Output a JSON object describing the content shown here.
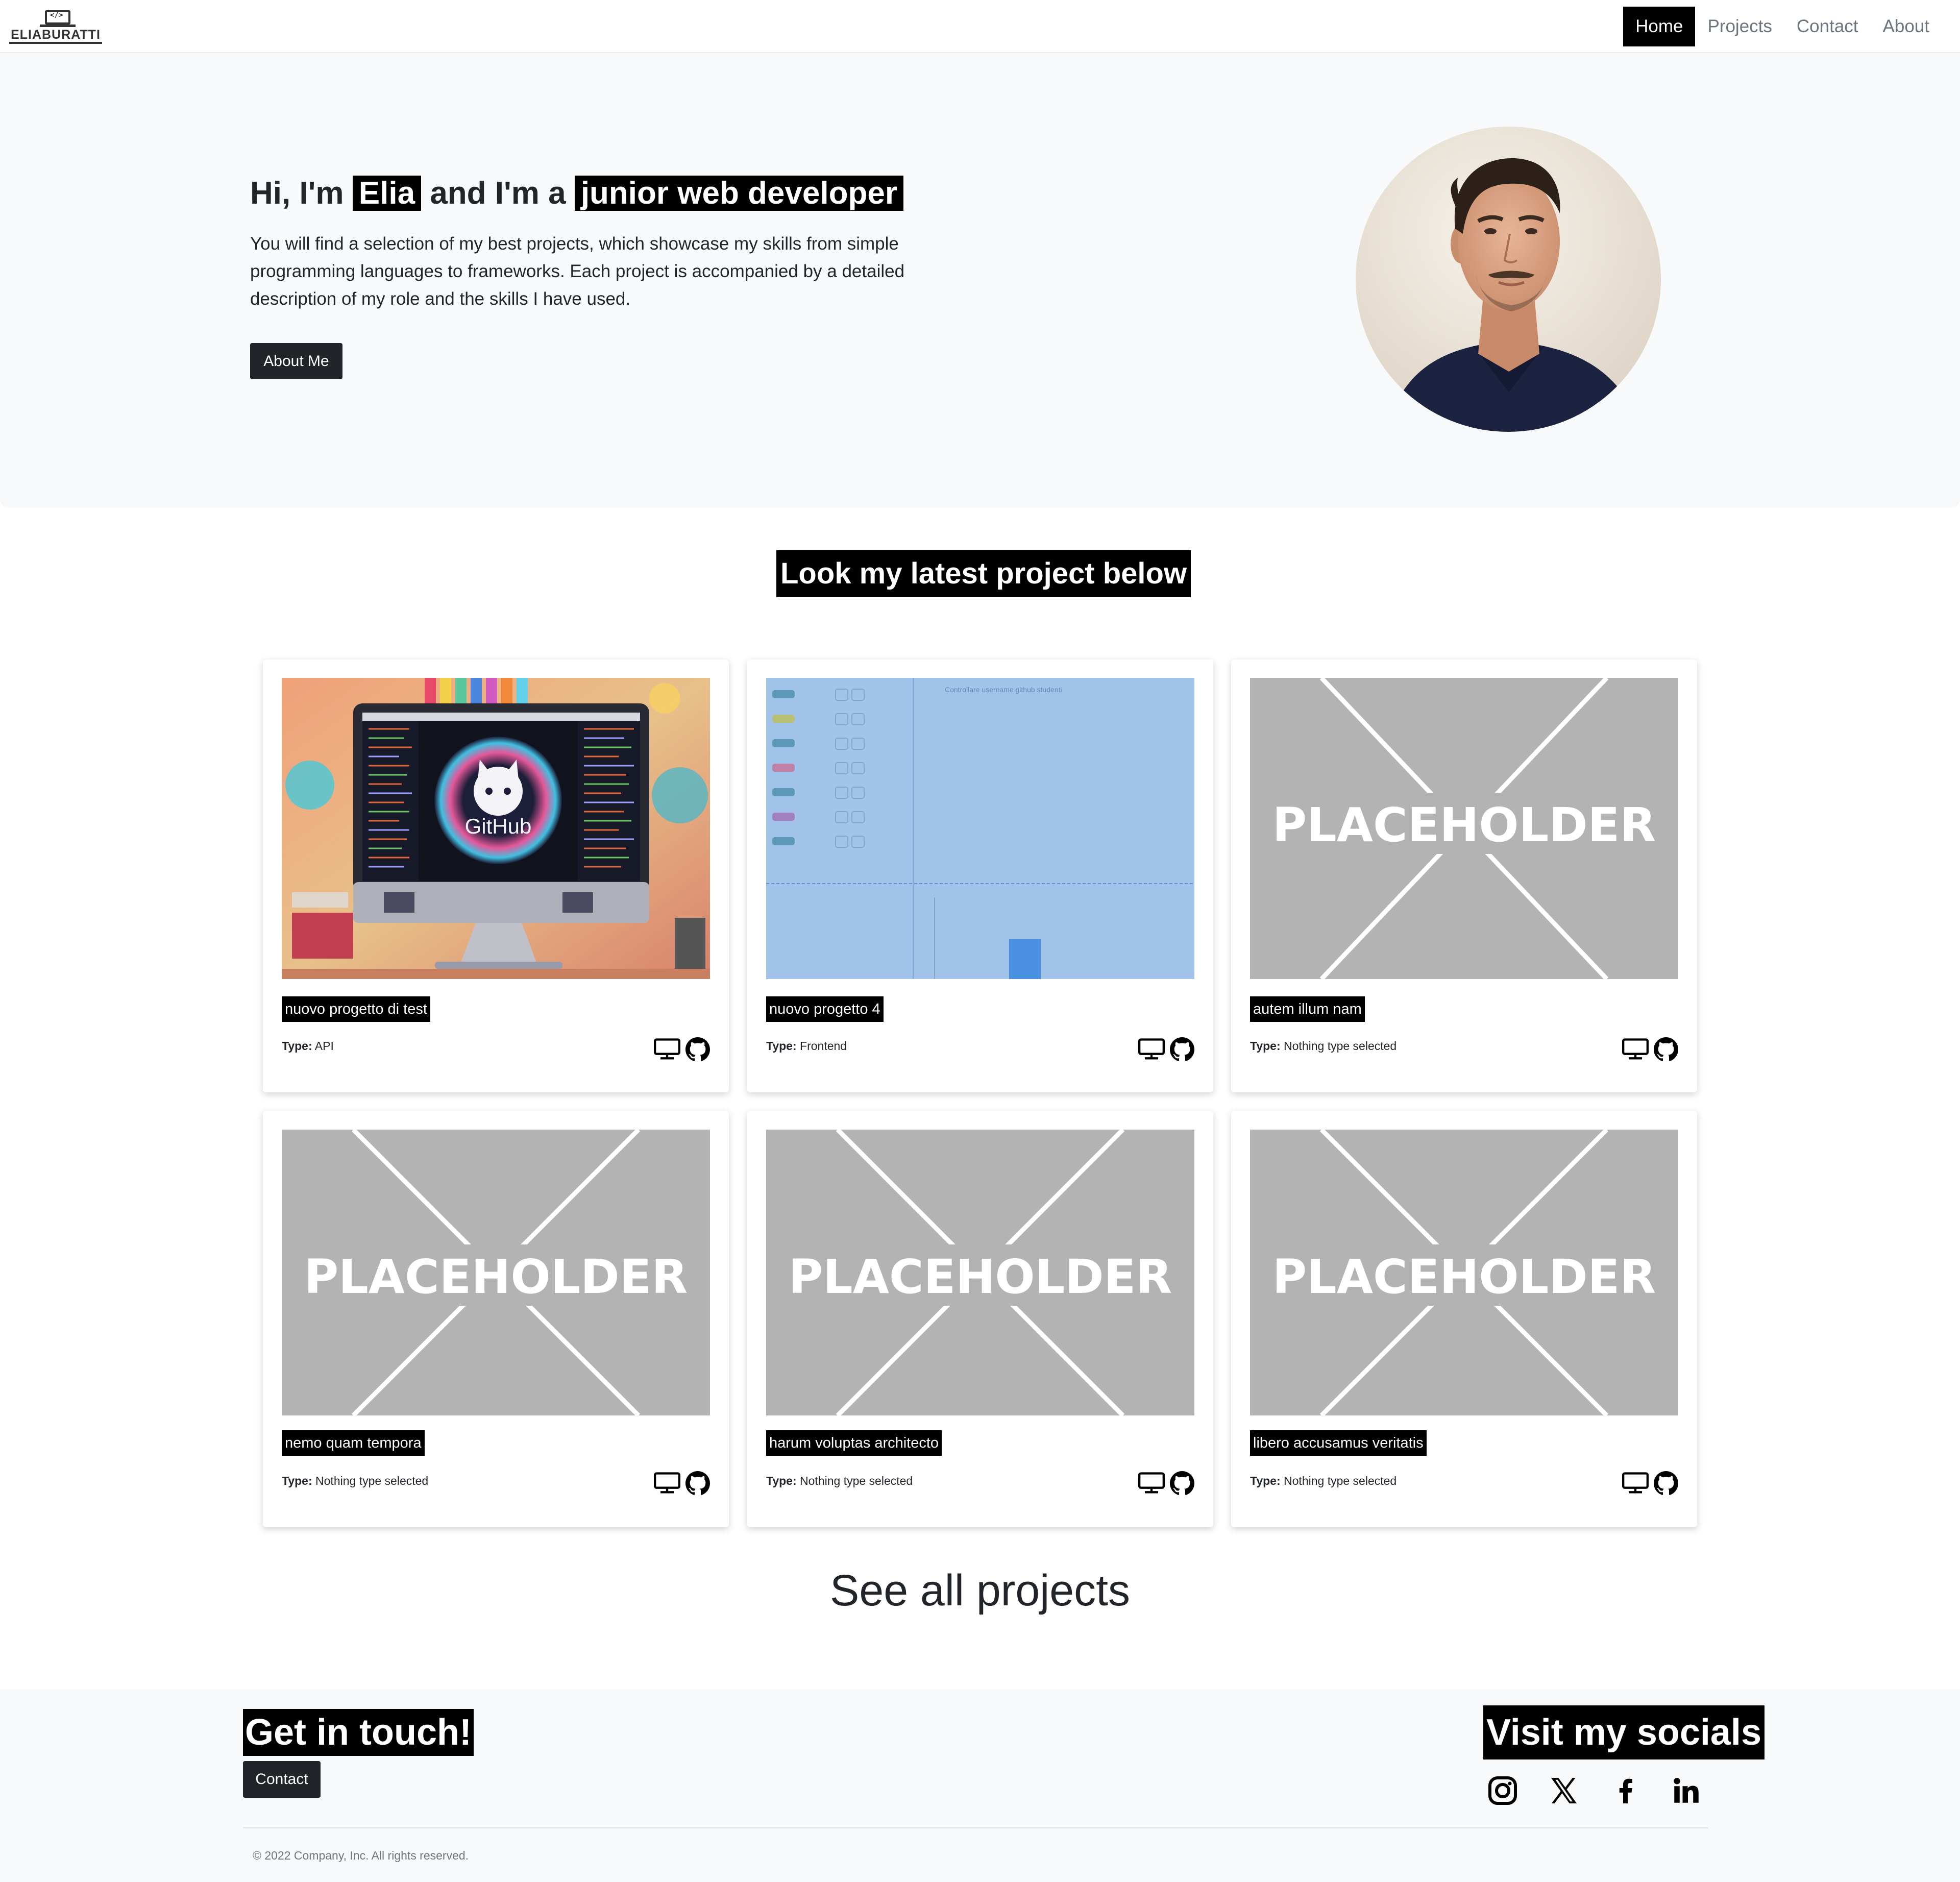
{
  "brand": {
    "logo_code": "</>",
    "logo_wordmark": "ELIABURATTI"
  },
  "nav": {
    "items": [
      {
        "label": "Home",
        "active": true
      },
      {
        "label": "Projects",
        "active": false
      },
      {
        "label": "Contact",
        "active": false
      },
      {
        "label": "About",
        "active": false
      }
    ]
  },
  "hero": {
    "greeting_prefix": "Hi, I'm",
    "name": "Elia",
    "greeting_middle": "and I'm a",
    "role": "junior web developer",
    "description": "You will find a selection of my best projects, which showcase my skills from simple programming languages to frameworks. Each project is accompanied by a detailed description of my role and the skills I have used.",
    "about_button": "About Me"
  },
  "projects_section": {
    "title": "Look my latest project below",
    "type_label": "Type:",
    "placeholder_text": "PLACEHOLDER",
    "cards": [
      {
        "title": "nuovo progetto di test",
        "type": "API",
        "image": "github-illustration"
      },
      {
        "title": "nuovo progetto 4",
        "type": "Frontend",
        "image": "app-screenshot",
        "screenshot_caption": "Controllare username github studenti"
      },
      {
        "title": "autem illum nam",
        "type": "Nothing type selected",
        "image": "placeholder"
      },
      {
        "title": "nemo quam tempora",
        "type": "Nothing type selected",
        "image": "placeholder"
      },
      {
        "title": "harum voluptas architecto",
        "type": "Nothing type selected",
        "image": "placeholder"
      },
      {
        "title": "libero accusamus veritatis",
        "type": "Nothing type selected",
        "image": "placeholder"
      }
    ],
    "see_all": "See all projects"
  },
  "footer": {
    "get_in_touch": "Get in touch!",
    "contact_button": "Contact",
    "socials_title": "Visit my socials",
    "socials": [
      "instagram-icon",
      "x-icon",
      "facebook-icon",
      "linkedin-icon"
    ],
    "copyright": "© 2022 Company, Inc. All rights reserved."
  },
  "colors": {
    "accent": "#000000",
    "button_dark": "#212529",
    "hero_bg": "#f8f9fa",
    "placeholder_bg": "#b3b3b3"
  }
}
